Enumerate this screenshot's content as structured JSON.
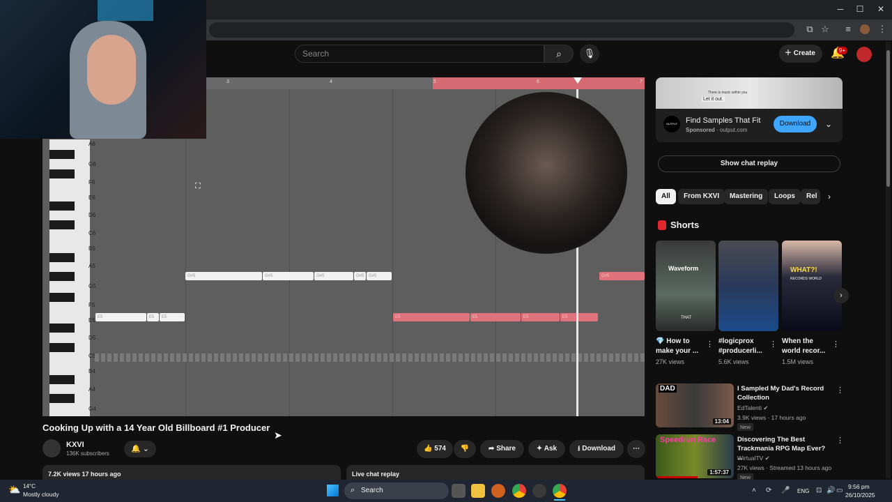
{
  "browser": {
    "window_controls": [
      "─",
      "☐",
      "✕"
    ]
  },
  "youtube": {
    "search_placeholder": "Search",
    "create_label": "Create",
    "notif_badge": "9+",
    "video": {
      "title": "Cooking Up with a 14 Year Old Billboard #1 Producer",
      "channel": "KXVI",
      "subscribers": "136K subscribers",
      "likes": "574",
      "share_label": "Share",
      "ask_label": "Ask",
      "download_label": "Download",
      "views_line": "7.2K views  17 hours ago",
      "live_chat_label": "Live chat replay"
    },
    "piano_roll": {
      "timeline_numbers": [
        "3",
        "4",
        "5",
        "6",
        "7"
      ],
      "note_labels": [
        "A6",
        "G6",
        "F6",
        "E6",
        "D6",
        "C6",
        "B5",
        "A5",
        "G5",
        "F5",
        "E5",
        "D5",
        "C5",
        "B4",
        "A4",
        "G4"
      ],
      "notes_white": [
        "G#5",
        "G#5",
        "G#5",
        "G#5",
        "G#5",
        "E5",
        "E5",
        "E5"
      ],
      "notes_red": [
        "G#5",
        "E5",
        "E5",
        "E5",
        "E5"
      ]
    },
    "ad": {
      "image_text": "Let it out.",
      "image_small_text": "There is music within you",
      "logo_text": "OUTPUT",
      "title": "Find Samples That Fit",
      "sponsored": "Sponsored",
      "domain": "· output.com",
      "download_label": "Download"
    },
    "show_chat_replay": "Show chat replay",
    "chips": [
      "All",
      "From KXVI",
      "Mastering",
      "Loops",
      "Rel"
    ],
    "shorts": {
      "heading": "Shorts",
      "items": [
        {
          "title": "💎 How to make your ...",
          "views": "27K views",
          "thumb_text": "Waveform",
          "thumb_sub": "THAT"
        },
        {
          "title": "#logicprox #producerli...",
          "views": "5.6K views",
          "thumb_text": "",
          "thumb_sub": ""
        },
        {
          "title": "When the world recor...",
          "views": "1.5M views",
          "thumb_text": "WHAT?!",
          "thumb_sub": "RECORDS WORLD"
        }
      ]
    },
    "recommendations": [
      {
        "title": "I Sampled My Dad's Record Collection",
        "channel": "EdTalenti ✔",
        "meta": "3.9K views · 17 hours ago",
        "badge": "New",
        "duration": "13:04",
        "thumb_text": "DAD"
      },
      {
        "title": "Discovering The Best Trackmania RPG Map Ever? ...",
        "channel": "WirtualTV ✔",
        "meta": "27K views · Streamed 13 hours ago",
        "badge": "New",
        "duration": "1:57:37",
        "thumb_text": "Speedrun Race"
      }
    ]
  },
  "taskbar": {
    "temperature": "14°C",
    "weather": "Mostly cloudy",
    "search_label": "Search",
    "language": "ENG",
    "time": "9:56 pm",
    "date": "26/10/2025"
  },
  "colors": {
    "yt_bg": "#0f0f0f",
    "accent_blue": "#3ea6ff",
    "note_red": "#e0727c",
    "yt_red": "#cc0000"
  }
}
